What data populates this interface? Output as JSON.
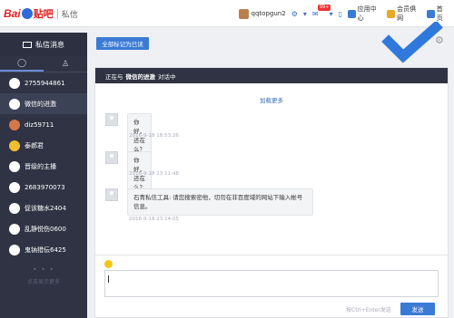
{
  "brand": {
    "bai": "Bai",
    "tieba": "贴吧",
    "page_title": "私信"
  },
  "header": {
    "username": "qqtopgun2",
    "mail_badge": "99+",
    "links": [
      "应用中心",
      "会员俱网",
      "首页"
    ]
  },
  "sidebar": {
    "title": "私信消息",
    "contacts": [
      {
        "name": "2755944861",
        "avatar_color": "#ffffff"
      },
      {
        "name": "微信的进激",
        "avatar_color": "#ffffff",
        "active": true
      },
      {
        "name": "diz59711",
        "avatar_color": "#d4784a"
      },
      {
        "name": "泰郝君",
        "avatar_color": "#f0c030"
      },
      {
        "name": "晋级的主播",
        "avatar_color": "#ffffff"
      },
      {
        "name": "2683970073",
        "avatar_color": "#ffffff"
      },
      {
        "name": "促该糖水2404",
        "avatar_color": "#ffffff"
      },
      {
        "name": "乱静悦伤0600",
        "avatar_color": "#ffffff"
      },
      {
        "name": "鬼钠猎伝6425",
        "avatar_color": "#ffffff"
      }
    ],
    "more_dots": "• • •",
    "more_label": "点击显示更多"
  },
  "toolbar": {
    "mark_all_read": "全部标记为已读"
  },
  "chat": {
    "header_prefix": "正在与",
    "header_name": "微信的进激",
    "header_suffix": "对话中",
    "load_more": "加载更多",
    "messages": [
      {
        "text": "你好，还在么？",
        "time": "2016-9-18 18:53:26"
      },
      {
        "text": "你好，还在么？",
        "time": "2016-9-18 23:11:48"
      },
      {
        "text": "石青私信工具: 请您搜索密他，切勿在非百度域的网站下输入帐号信息。",
        "time": "2016-9-18 23:14:05"
      }
    ],
    "input_value": "",
    "send_hint": "按Ctrl+Enter发送",
    "send_label": "发送"
  },
  "colors": {
    "accent": "#3a7bd5",
    "sidebar_bg": "#2f3343",
    "brand_red": "#e02020",
    "check_blue": "#2f79dd"
  }
}
